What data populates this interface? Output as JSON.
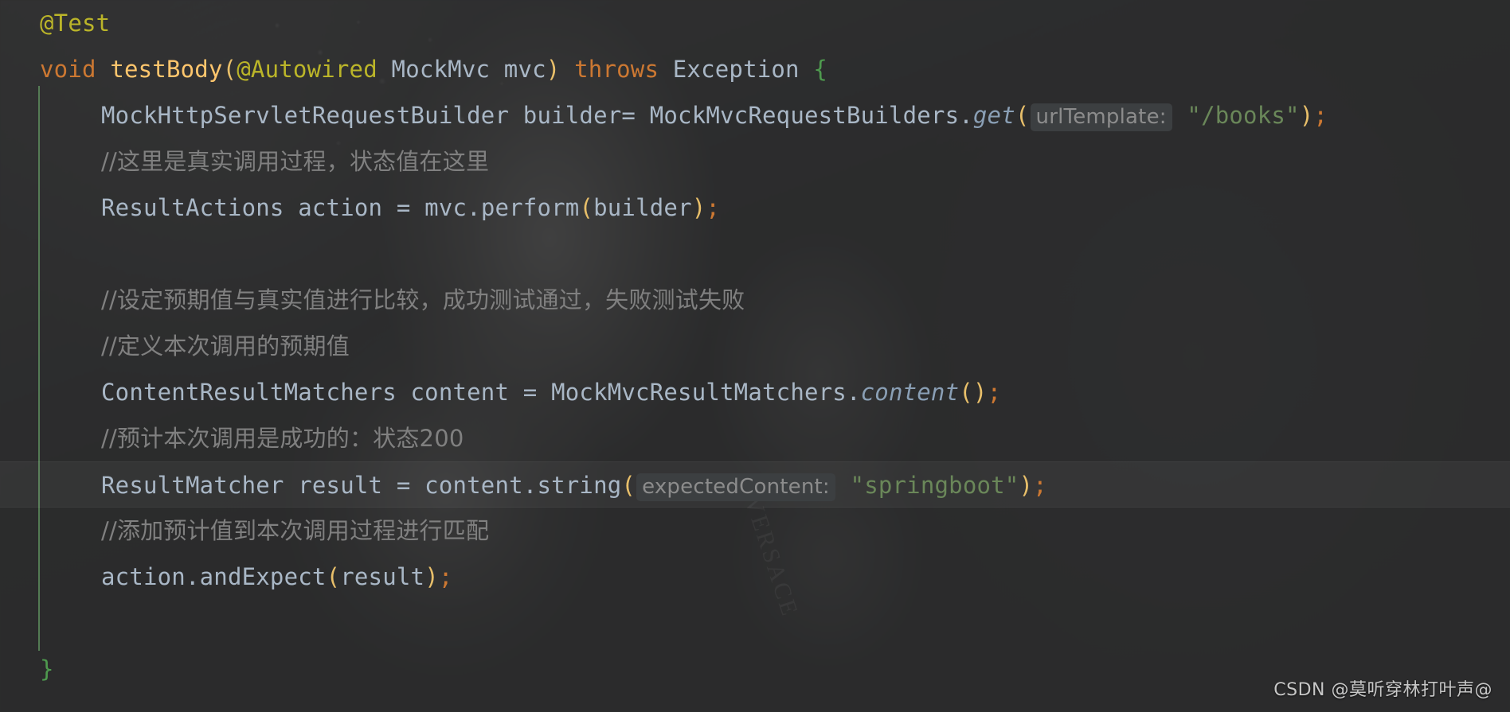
{
  "editor": {
    "language": "Java",
    "theme": "Darcula",
    "caret_line_index": 11,
    "colors": {
      "background": "#2b2b2b",
      "annotation": "#bbb529",
      "keyword": "#cc7832",
      "method": "#ffc66d",
      "plain_text": "#a9b7c6",
      "string": "#6a8759",
      "comment": "#808080",
      "parens": "#e8bf6a",
      "brace": "#4e9a4e",
      "hint_background": "#3c3f41",
      "hint_text": "#8c8c8c",
      "caret_row_highlight": "#323232"
    },
    "lines": [
      {
        "index": 0,
        "indent": 0,
        "tokens": [
          {
            "text": "@Test",
            "type": "annotation"
          }
        ]
      },
      {
        "index": 1,
        "indent": 0,
        "tokens": [
          {
            "text": "void",
            "type": "keyword"
          },
          {
            "text": " ",
            "type": "plain"
          },
          {
            "text": "testBody",
            "type": "method"
          },
          {
            "text": "(",
            "type": "paren"
          },
          {
            "text": "@Autowired",
            "type": "annotation"
          },
          {
            "text": " MockMvc mvc",
            "type": "plain"
          },
          {
            "text": ")",
            "type": "paren"
          },
          {
            "text": " ",
            "type": "plain"
          },
          {
            "text": "throws",
            "type": "keyword"
          },
          {
            "text": " Exception ",
            "type": "plain"
          },
          {
            "text": "{",
            "type": "brace"
          }
        ]
      },
      {
        "index": 2,
        "indent": 1,
        "tokens": [
          {
            "text": "MockHttpServletRequestBuilder builder= MockMvcRequestBuilders.",
            "type": "plain"
          },
          {
            "text": "get",
            "type": "method-italic"
          },
          {
            "text": "(",
            "type": "paren"
          },
          {
            "text": "urlTemplate:",
            "type": "hint"
          },
          {
            "text": " ",
            "type": "plain"
          },
          {
            "text": "\"/books\"",
            "type": "string"
          },
          {
            "text": ")",
            "type": "paren"
          },
          {
            "text": ";",
            "type": "semicolon"
          }
        ]
      },
      {
        "index": 3,
        "indent": 1,
        "tokens": [
          {
            "text": "//这里是真实调用过程，状态值在这里",
            "type": "comment"
          }
        ]
      },
      {
        "index": 4,
        "indent": 1,
        "tokens": [
          {
            "text": "ResultActions action = mvc.",
            "type": "plain"
          },
          {
            "text": "perform",
            "type": "plain"
          },
          {
            "text": "(",
            "type": "paren"
          },
          {
            "text": "builder",
            "type": "plain"
          },
          {
            "text": ")",
            "type": "paren"
          },
          {
            "text": ";",
            "type": "semicolon"
          }
        ]
      },
      {
        "index": 5,
        "indent": 1,
        "tokens": []
      },
      {
        "index": 6,
        "indent": 1,
        "tokens": [
          {
            "text": "//设定预期值与真实值进行比较，成功测试通过，失败测试失败",
            "type": "comment"
          }
        ]
      },
      {
        "index": 7,
        "indent": 1,
        "tokens": [
          {
            "text": "//定义本次调用的预期值",
            "type": "comment"
          }
        ]
      },
      {
        "index": 8,
        "indent": 1,
        "tokens": [
          {
            "text": "ContentResultMatchers content = MockMvcResultMatchers.",
            "type": "plain"
          },
          {
            "text": "content",
            "type": "method-italic"
          },
          {
            "text": "(",
            "type": "paren"
          },
          {
            "text": ")",
            "type": "paren"
          },
          {
            "text": ";",
            "type": "semicolon"
          }
        ]
      },
      {
        "index": 9,
        "indent": 1,
        "tokens": [
          {
            "text": "//预计本次调用是成功的：状态200",
            "type": "comment"
          }
        ]
      },
      {
        "index": 10,
        "indent": 1,
        "caret": true,
        "tokens": [
          {
            "text": "ResultMatcher result = content.",
            "type": "plain"
          },
          {
            "text": "string",
            "type": "plain"
          },
          {
            "text": "(",
            "type": "paren"
          },
          {
            "text": "expectedContent:",
            "type": "hint"
          },
          {
            "text": " ",
            "type": "plain"
          },
          {
            "text": "\"springboot\"",
            "type": "string"
          },
          {
            "text": ")",
            "type": "paren"
          },
          {
            "text": ";",
            "type": "semicolon"
          }
        ]
      },
      {
        "index": 11,
        "indent": 1,
        "tokens": [
          {
            "text": "//添加预计值到本次调用过程进行匹配",
            "type": "comment"
          }
        ]
      },
      {
        "index": 12,
        "indent": 1,
        "tokens": [
          {
            "text": "action.",
            "type": "plain"
          },
          {
            "text": "andExpect",
            "type": "plain"
          },
          {
            "text": "(",
            "type": "paren"
          },
          {
            "text": "result",
            "type": "plain"
          },
          {
            "text": ")",
            "type": "paren"
          },
          {
            "text": ";",
            "type": "semicolon"
          }
        ]
      },
      {
        "index": 13,
        "indent": 0,
        "tokens": []
      },
      {
        "index": 14,
        "indent": 0,
        "tokens": [
          {
            "text": "}",
            "type": "brace"
          }
        ]
      }
    ]
  },
  "background": {
    "wordmark": "VERSACE"
  },
  "watermark": {
    "text": "CSDN @莫听穿林打叶声@"
  }
}
